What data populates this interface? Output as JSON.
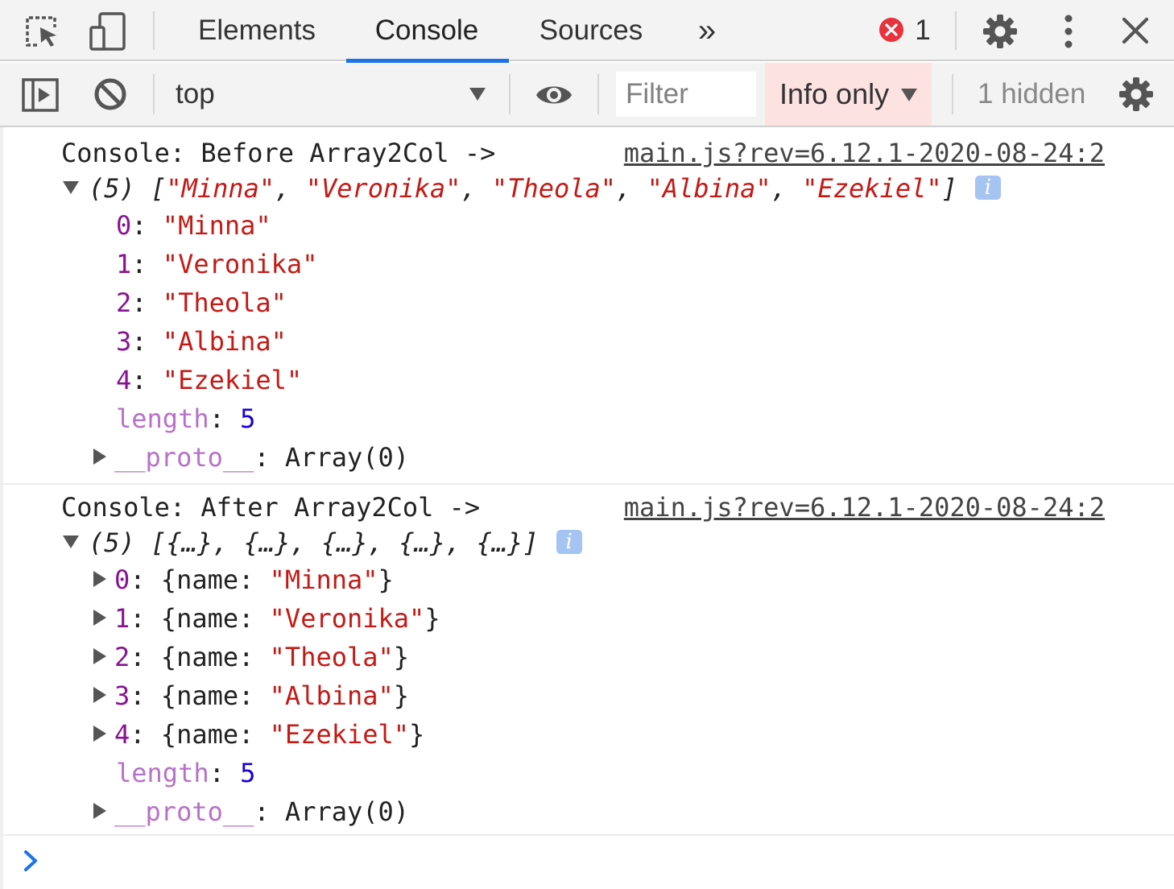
{
  "tabs": {
    "items": [
      {
        "label": "Elements"
      },
      {
        "label": "Console",
        "active": true
      },
      {
        "label": "Sources"
      }
    ],
    "more": "»",
    "error_count": "1"
  },
  "toolbar": {
    "context": "top",
    "filter_placeholder": "Filter",
    "levels": "Info only",
    "hidden": "1 hidden"
  },
  "colors": {
    "accent": "#1a73e8",
    "string": "#c41a16",
    "key": "#881391",
    "number": "#1c00cf",
    "error": "#e8323c",
    "levels_bg": "#fde2e2"
  },
  "icons": [
    "inspect-icon",
    "device-toolbar-icon",
    "error-icon",
    "gear-icon",
    "kebab-menu-icon",
    "close-icon",
    "sidebar-toggle-icon",
    "clear-icon",
    "eye-icon",
    "prompt-chevron-icon"
  ],
  "messages": [
    {
      "label": "Console: Before Array2Col ->",
      "source": "main.js?rev=6.12.1-2020-08-24:2",
      "count": "(5)",
      "preview": [
        "Minna",
        "Veronika",
        "Theola",
        "Albina",
        "Ezekiel"
      ],
      "entries": [
        {
          "index": "0",
          "value": "\"Minna\""
        },
        {
          "index": "1",
          "value": "\"Veronika\""
        },
        {
          "index": "2",
          "value": "\"Theola\""
        },
        {
          "index": "3",
          "value": "\"Albina\""
        },
        {
          "index": "4",
          "value": "\"Ezekiel\""
        }
      ],
      "length_key": "length",
      "length_value": "5",
      "proto_key": "__proto__",
      "proto_value": "Array(0)"
    },
    {
      "label": "Console: After Array2Col ->",
      "source": "main.js?rev=6.12.1-2020-08-24:2",
      "count": "(5)",
      "preview_text": "[{…}, {…}, {…}, {…}, {…}]",
      "entries": [
        {
          "index": "0",
          "prop": "name",
          "value": "\"Minna\""
        },
        {
          "index": "1",
          "prop": "name",
          "value": "\"Veronika\""
        },
        {
          "index": "2",
          "prop": "name",
          "value": "\"Theola\""
        },
        {
          "index": "3",
          "prop": "name",
          "value": "\"Albina\""
        },
        {
          "index": "4",
          "prop": "name",
          "value": "\"Ezekiel\""
        }
      ],
      "length_key": "length",
      "length_value": "5",
      "proto_key": "__proto__",
      "proto_value": "Array(0)"
    }
  ]
}
